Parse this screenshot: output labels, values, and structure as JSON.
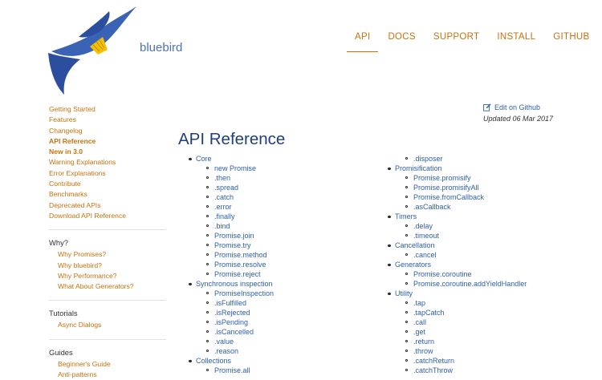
{
  "brand": {
    "name": "bluebird",
    "logo_icon": "bluebird-logo-icon"
  },
  "nav": [
    {
      "label": "API",
      "active": true
    },
    {
      "label": "DOCS"
    },
    {
      "label": "SUPPORT"
    },
    {
      "label": "INSTALL"
    },
    {
      "label": "GITHUB"
    }
  ],
  "colors": {
    "accent": "#c5720e",
    "link": "#2f5fa5",
    "title": "#1f3f7a",
    "logo_blue": "#2b4f9e",
    "logo_yellow": "#f2c200"
  },
  "sidebar": {
    "links": [
      {
        "label": "Getting Started"
      },
      {
        "label": "Features"
      },
      {
        "label": "Changelog"
      },
      {
        "label": "API Reference",
        "bold": true
      },
      {
        "label": "New in 3.0",
        "bold": true
      },
      {
        "label": "Warning Explanations"
      },
      {
        "label": "Error Explanations"
      },
      {
        "label": "Contribute"
      },
      {
        "label": "Benchmarks"
      },
      {
        "label": "Deprecated APIs"
      },
      {
        "label": "Download API Reference"
      }
    ],
    "why": {
      "heading": "Why?",
      "items": [
        "Why Promises?",
        "Why bluebird?",
        "Why Performance?",
        "What About Generators?"
      ]
    },
    "tutorials": {
      "heading": "Tutorials",
      "items": [
        "Async Dialogs"
      ]
    },
    "guides": {
      "heading": "Guides",
      "items": [
        "Beginner's Guide",
        "Anti-patterns"
      ]
    }
  },
  "edit": {
    "label": "Edit on Github",
    "icon": "edit-icon"
  },
  "updated": "Updated 06 Mar 2017",
  "page_title": "API Reference",
  "toc": {
    "col1": [
      {
        "label": "Core",
        "level": 1
      },
      {
        "label": "new Promise",
        "level": 2
      },
      {
        "label": ".then",
        "level": 2
      },
      {
        "label": ".spread",
        "level": 2
      },
      {
        "label": ".catch",
        "level": 2
      },
      {
        "label": ".error",
        "level": 2
      },
      {
        "label": ".finally",
        "level": 2
      },
      {
        "label": ".bind",
        "level": 2
      },
      {
        "label": "Promise.join",
        "level": 2
      },
      {
        "label": "Promise.try",
        "level": 2
      },
      {
        "label": "Promise.method",
        "level": 2
      },
      {
        "label": "Promise.resolve",
        "level": 2
      },
      {
        "label": "Promise.reject",
        "level": 2
      },
      {
        "label": "Synchronous inspection",
        "level": 1
      },
      {
        "label": "PromiseInspection",
        "level": 2
      },
      {
        "label": ".isFulfilled",
        "level": 2
      },
      {
        "label": ".isRejected",
        "level": 2
      },
      {
        "label": ".isPending",
        "level": 2
      },
      {
        "label": ".isCancelled",
        "level": 2
      },
      {
        "label": ".value",
        "level": 2
      },
      {
        "label": ".reason",
        "level": 2
      },
      {
        "label": "Collections",
        "level": 1
      },
      {
        "label": "Promise.all",
        "level": 2
      }
    ],
    "col2": [
      {
        "label": ".disposer",
        "level": 2
      },
      {
        "label": "Promisification",
        "level": 1
      },
      {
        "label": "Promise.promisify",
        "level": 2
      },
      {
        "label": "Promise.promisifyAll",
        "level": 2
      },
      {
        "label": "Promise.fromCallback",
        "level": 2
      },
      {
        "label": ".asCallback",
        "level": 2
      },
      {
        "label": "Timers",
        "level": 1
      },
      {
        "label": ".delay",
        "level": 2
      },
      {
        "label": ".timeout",
        "level": 2
      },
      {
        "label": "Cancellation",
        "level": 1
      },
      {
        "label": ".cancel",
        "level": 2
      },
      {
        "label": "Generators",
        "level": 1
      },
      {
        "label": "Promise.coroutine",
        "level": 2
      },
      {
        "label": "Promise.coroutine.addYieldHandler",
        "level": 2
      },
      {
        "label": "Utility",
        "level": 1
      },
      {
        "label": ".tap",
        "level": 2
      },
      {
        "label": ".tapCatch",
        "level": 2
      },
      {
        "label": ".call",
        "level": 2
      },
      {
        "label": ".get",
        "level": 2
      },
      {
        "label": ".return",
        "level": 2
      },
      {
        "label": ".throw",
        "level": 2
      },
      {
        "label": ".catchReturn",
        "level": 2
      },
      {
        "label": ".catchThrow",
        "level": 2
      }
    ]
  }
}
